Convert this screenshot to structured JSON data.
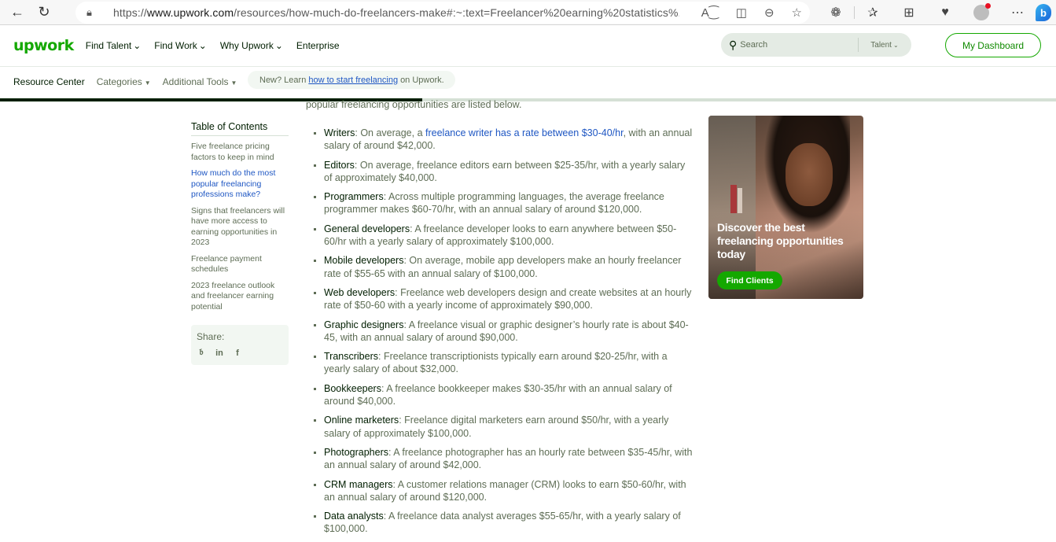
{
  "browser": {
    "url_prefix": "https://",
    "url_domain": "www.upwork.com",
    "url_rest": "/resources/how-much-do-freelancers-make#:~:text=Freelancer%20earning%20statistics%...",
    "icons": [
      "back-icon",
      "refresh-icon",
      "lock-icon",
      "read-aloud-icon",
      "immersive-reader-icon",
      "zoom-out-icon",
      "favorite-icon",
      "extensions-icon",
      "favorites-icon",
      "collections-icon",
      "health-icon",
      "profile-icon",
      "more-icon",
      "bing-icon"
    ]
  },
  "header": {
    "logo": "upwork",
    "nav": [
      {
        "label": "Find Talent",
        "dropdown": true
      },
      {
        "label": "Find Work",
        "dropdown": true
      },
      {
        "label": "Why Upwork",
        "dropdown": true
      },
      {
        "label": "Enterprise",
        "dropdown": false
      }
    ],
    "search": {
      "placeholder": "Search",
      "category": "Talent"
    },
    "dashboard_button": "My Dashboard"
  },
  "subnav": {
    "resource_center": "Resource Center",
    "categories": "Categories",
    "additional_tools": "Additional Tools",
    "promo_prefix": "New? Learn",
    "promo_link": "how to start freelancing",
    "promo_suffix": "on Upwork."
  },
  "reading_progress_percent": 40,
  "article": {
    "intro_fragment": "popular freelancing opportunities are listed below.",
    "items": [
      {
        "term": "Writers",
        "pre": " On average, a ",
        "link": "freelance writer has a rate between $30-40/hr",
        "post": ", with an annual salary of around $42,000."
      },
      {
        "term": "Editors",
        "pre": " On average, freelance editors earn between $25-35/hr, with a yearly salary of approximately $40,000.",
        "link": "",
        "post": ""
      },
      {
        "term": "Programmers",
        "pre": " Across multiple programming languages, the average freelance programmer makes $60-70/hr, with an annual salary of around $120,000.",
        "link": "",
        "post": ""
      },
      {
        "term": "General developers",
        "pre": " A freelance developer looks to earn anywhere between $50-60/hr with a yearly salary of approximately $100,000.",
        "link": "",
        "post": ""
      },
      {
        "term": "Mobile developers",
        "pre": " On average, mobile app developers make an hourly freelancer rate of $55-65 with an annual salary of $100,000.",
        "link": "",
        "post": ""
      },
      {
        "term": "Web developers",
        "pre": " Freelance web developers design and create websites at an hourly rate of $50-60 with a yearly income of approximately $90,000.",
        "link": "",
        "post": ""
      },
      {
        "term": "Graphic designers",
        "pre": " A freelance visual or graphic designer’s hourly rate is about $40-45, with an annual salary of around $90,000.",
        "link": "",
        "post": ""
      },
      {
        "term": "Transcribers",
        "pre": " Freelance transcriptionists typically earn around $20-25/hr, with a yearly salary of about $32,000.",
        "link": "",
        "post": ""
      },
      {
        "term": "Bookkeepers",
        "pre": " A freelance bookkeeper makes $30-35/hr with an annual salary of around $40,000.",
        "link": "",
        "post": ""
      },
      {
        "term": "Online marketers",
        "pre": " Freelance digital marketers earn around $50/hr, with a yearly salary of approximately $100,000.",
        "link": "",
        "post": ""
      },
      {
        "term": "Photographers",
        "pre": " A freelance photographer has an hourly rate between $35-45/hr, with an annual salary of around $42,000.",
        "link": "",
        "post": ""
      },
      {
        "term": "CRM managers",
        "pre": " A customer relations manager (CRM) looks to earn $50-60/hr, with an annual salary of around $120,000.",
        "link": "",
        "post": ""
      },
      {
        "term": "Data analysts",
        "pre": " A freelance data analyst averages $55-65/hr, with a yearly salary of $100,000.",
        "link": "",
        "post": ""
      }
    ]
  },
  "toc": {
    "title": "Table of Contents",
    "items": [
      {
        "label": "Five freelance pricing factors to keep in mind",
        "active": false
      },
      {
        "label": "How much do the most popular freelancing professions make?",
        "active": true
      },
      {
        "label": "Signs that freelancers will have more access to earning opportunities in 2023",
        "active": false
      },
      {
        "label": "Freelance payment schedules",
        "active": false
      },
      {
        "label": "2023 freelance outlook and freelancer earning potential",
        "active": false
      }
    ],
    "share_label": "Share:",
    "share_icons": [
      "twitter-icon",
      "linkedin-icon",
      "facebook-icon"
    ]
  },
  "ad": {
    "title": "Discover the best freelancing opportunities today",
    "button": "Find Clients"
  },
  "colors": {
    "brand_green": "#14a800",
    "dark": "#001e00",
    "muted": "#5e6d55",
    "link": "#1f57c3"
  }
}
